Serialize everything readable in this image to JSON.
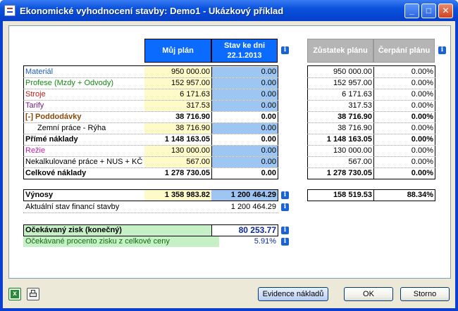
{
  "window": {
    "title": "Ekonomické vyhodnocení stavby:  Demo1 - Ukázkový příklad"
  },
  "headers": {
    "muj_plan": "Můj plán",
    "stav_line1": "Stav ke dni",
    "stav_line2": "22.1.2013",
    "zustatek": "Zůstatek plánu",
    "cerpani": "Čerpání plánu"
  },
  "rows": [
    {
      "label": "Materiál",
      "color": "#1a5ec8",
      "plan": "950 000.00",
      "stav": "0.00",
      "zust": "950 000.00",
      "cerp": "0.00%",
      "bold": false
    },
    {
      "label": "Profese (Mzdy + Odvody)",
      "color": "#138a13",
      "plan": "152 957.00",
      "stav": "0.00",
      "zust": "152 957.00",
      "cerp": "0.00%",
      "bold": false
    },
    {
      "label": "Stroje",
      "color": "#c01a1a",
      "plan": "6 171.63",
      "stav": "0.00",
      "zust": "6 171.63",
      "cerp": "0.00%",
      "bold": false
    },
    {
      "label": "Tarify",
      "color": "#7a1a8a",
      "plan": "317.53",
      "stav": "0.00",
      "zust": "317.53",
      "cerp": "0.00%",
      "bold": false
    },
    {
      "label": "[-] Poddodávky",
      "color": "#8a4a0a",
      "plan": "38 716.90",
      "stav": "0.00",
      "zust": "38 716.90",
      "cerp": "0.00%",
      "bold": true
    },
    {
      "label": "Zemní práce - Rýha",
      "color": "#000000",
      "plan": "38 716.90",
      "stav": "0.00",
      "zust": "38 716.90",
      "cerp": "0.00%",
      "bold": false,
      "indent": true
    },
    {
      "label": "Přímé náklady",
      "color": "#000000",
      "plan": "1 148 163.05",
      "stav": "0.00",
      "zust": "1 148 163.05",
      "cerp": "0.00%",
      "bold": true
    },
    {
      "label": "Režie",
      "color": "#c01ab0",
      "plan": "130 000.00",
      "stav": "0.00",
      "zust": "130 000.00",
      "cerp": "0.00%",
      "bold": false
    },
    {
      "label": "Nekalkulované práce + NUS + KČ",
      "color": "#000000",
      "plan": "567.00",
      "stav": "0.00",
      "zust": "567.00",
      "cerp": "0.00%",
      "bold": false
    },
    {
      "label": "Celkové náklady",
      "color": "#000000",
      "plan": "1 278 730.05",
      "stav": "0.00",
      "zust": "1 278 730.05",
      "cerp": "0.00%",
      "bold": true
    }
  ],
  "vynosy": {
    "label": "Výnosy",
    "plan": "1 358 983.82",
    "stav": "1 200 464.29",
    "zust": "158 519.53",
    "cerp": "88.34%"
  },
  "finance": {
    "label": "Aktuální stav financí stavby",
    "value": "1 200 464.29"
  },
  "zisk": {
    "label": "Očekávaný zisk (konečný)",
    "value": "80 253.77"
  },
  "procento": {
    "label": "Očekávané procento zisku z celkové ceny",
    "value": "5.91%"
  },
  "buttons": {
    "evidence": "Evidence nákladů",
    "ok": "OK",
    "storno": "Storno"
  },
  "icons": {
    "info": "i"
  }
}
